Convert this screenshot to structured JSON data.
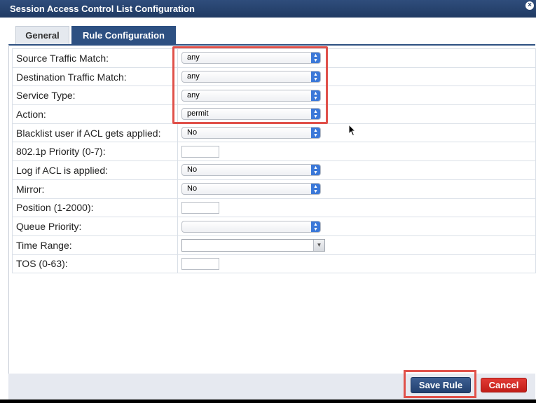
{
  "dialog": {
    "title": "Session Access Control List Configuration",
    "close_glyph": "×"
  },
  "tabs": [
    {
      "label": "General",
      "active": false
    },
    {
      "label": "Rule Configuration",
      "active": true
    }
  ],
  "form": {
    "rows": [
      {
        "label": "Source Traffic Match:",
        "control": "select",
        "value": "any"
      },
      {
        "label": "Destination Traffic Match:",
        "control": "select",
        "value": "any"
      },
      {
        "label": "Service Type:",
        "control": "select",
        "value": "any"
      },
      {
        "label": "Action:",
        "control": "select",
        "value": "permit"
      },
      {
        "label": "Blacklist user if ACL gets applied:",
        "control": "select",
        "value": "No"
      },
      {
        "label": "802.1p Priority (0-7):",
        "control": "text",
        "value": ""
      },
      {
        "label": "Log if ACL is applied:",
        "control": "select",
        "value": "No"
      },
      {
        "label": "Mirror:",
        "control": "select",
        "value": "No"
      },
      {
        "label": "Position (1-2000):",
        "control": "text",
        "value": ""
      },
      {
        "label": "Queue Priority:",
        "control": "select",
        "value": ""
      },
      {
        "label": "Time Range:",
        "control": "combo",
        "value": ""
      },
      {
        "label": "TOS (0-63):",
        "control": "text",
        "value": ""
      }
    ]
  },
  "buttons": {
    "save": "Save Rule",
    "cancel": "Cancel"
  },
  "colors": {
    "title_bar": "#203a63",
    "active_tab": "#2d5082",
    "highlight": "#e0514a",
    "cancel": "#c11d18",
    "select_arrow": "#3b78d8"
  },
  "icons": {
    "select_arrow": "up-down-chevron-icon",
    "combo_arrow": "triangle-down-icon",
    "close": "close-icon",
    "cursor": "mouse-pointer-icon"
  }
}
